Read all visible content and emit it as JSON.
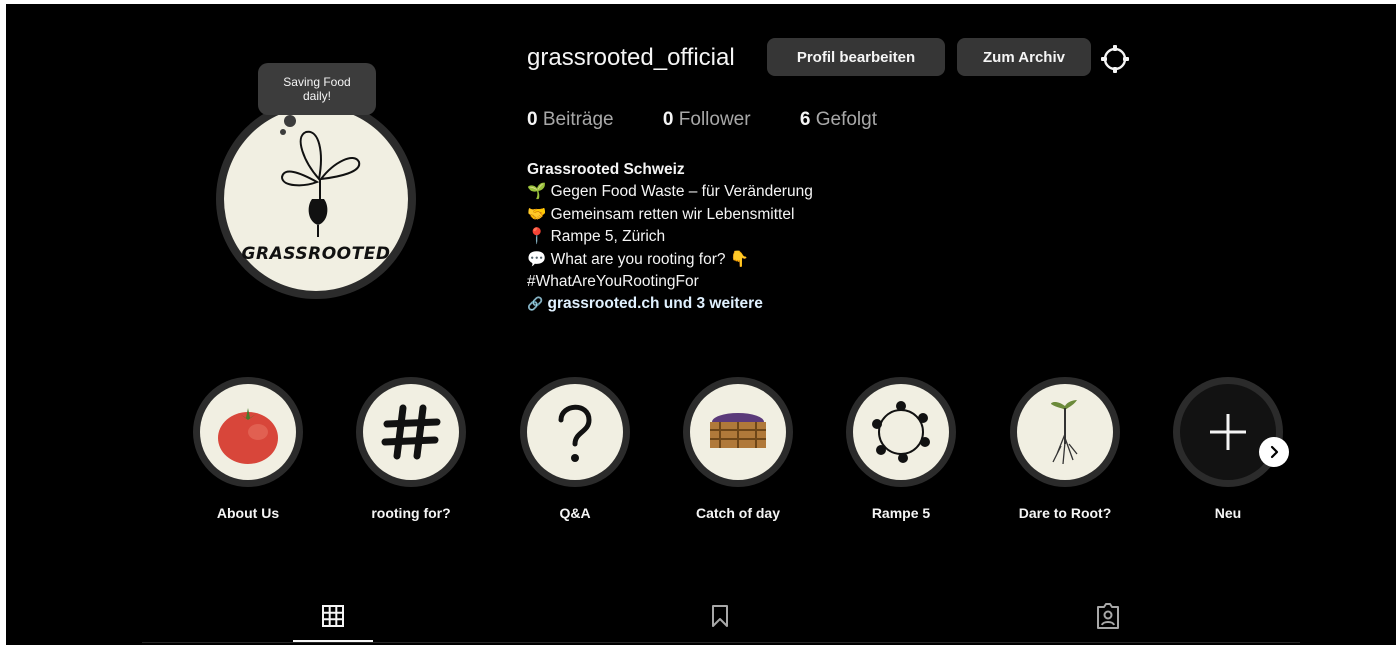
{
  "profile": {
    "username": "grassrooted_official",
    "note": "Saving Food daily!",
    "avatar_wordmark": "GRASSROOTED",
    "buttons": {
      "edit": "Profil bearbeiten",
      "archive": "Zum Archiv"
    },
    "stats": [
      {
        "count": "0",
        "label": "Beiträge"
      },
      {
        "count": "0",
        "label": "Follower"
      },
      {
        "count": "6",
        "label": "Gefolgt"
      }
    ],
    "bio": {
      "name": "Grassrooted Schweiz",
      "lines": [
        "🌱 Gegen Food Waste – für Veränderung",
        "🤝 Gemeinsam retten wir Lebensmittel",
        "📍 Rampe 5, Zürich",
        "💬 What are you rooting for? 👇",
        "#WhatAreYouRootingFor"
      ],
      "link": "grassrooted.ch und 3 weitere"
    }
  },
  "highlights": [
    {
      "label": "About Us",
      "icon": "tomato-icon"
    },
    {
      "label": "rooting for?",
      "icon": "hashtag-icon"
    },
    {
      "label": "Q&A",
      "icon": "question-mark-icon"
    },
    {
      "label": "Catch of day",
      "icon": "crate-icon"
    },
    {
      "label": "Rampe 5",
      "icon": "people-circle-icon"
    },
    {
      "label": "Dare to Root?",
      "icon": "sprout-root-icon"
    },
    {
      "label": "Neu",
      "icon": "plus-icon"
    }
  ],
  "tabs": [
    {
      "icon": "grid-icon",
      "active": true
    },
    {
      "icon": "bookmark-icon",
      "active": false
    },
    {
      "icon": "tagged-icon",
      "active": false
    }
  ]
}
